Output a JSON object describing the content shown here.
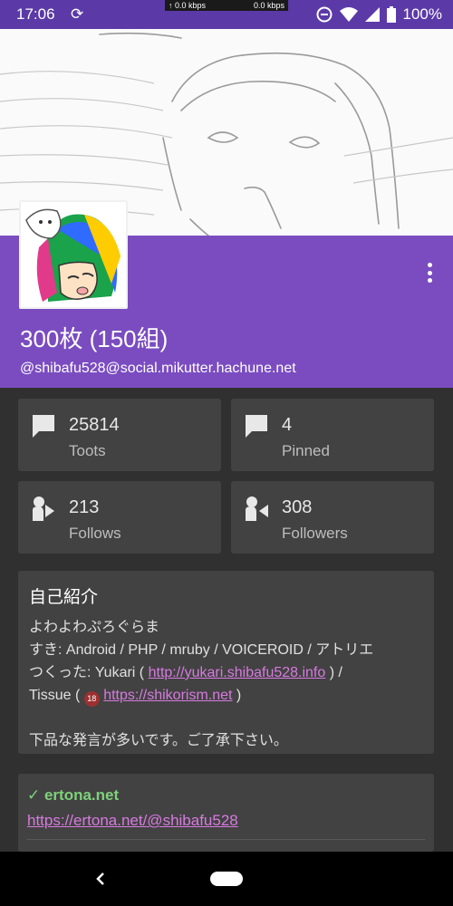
{
  "status_bar": {
    "time": "17:06",
    "net_up": "↑  0.0 kbps",
    "net_down": "0.0 kbps",
    "battery": "100%"
  },
  "profile": {
    "display_name": "300枚 (150組)",
    "handle": "@shibafu528@social.mikutter.hachune.net"
  },
  "stats": [
    {
      "value": "25814",
      "label": "Toots",
      "icon": "chat-bubble-icon"
    },
    {
      "value": "4",
      "label": "Pinned",
      "icon": "chat-bubble-icon"
    },
    {
      "value": "213",
      "label": "Follows",
      "icon": "follows-icon"
    },
    {
      "value": "308",
      "label": "Followers",
      "icon": "followers-icon"
    }
  ],
  "bio": {
    "title": "自己紹介",
    "line1": "よわよわぷろぐらま",
    "line2": "すき: Android / PHP / mruby / VOICEROID / アトリエ",
    "line3_prefix": "つくった: Yukari ( ",
    "line3_link": "http://yukari.shibafu528.info",
    "line3_suffix": " ) /",
    "line4_prefix": "Tissue ( ",
    "line4_badge": "18",
    "line4_link": "https://shikorism.net",
    "line4_suffix": " )",
    "line5": "下品な発言が多いです。ご了承下さい。"
  },
  "links": {
    "domain": "✓ ertona.net",
    "url": "https://ertona.net/@shibafu528"
  },
  "colors": {
    "accent": "#7a4cc0",
    "status_bar": "#5b3aa8",
    "link": "#d77ae0",
    "verified": "#7fd17c"
  }
}
